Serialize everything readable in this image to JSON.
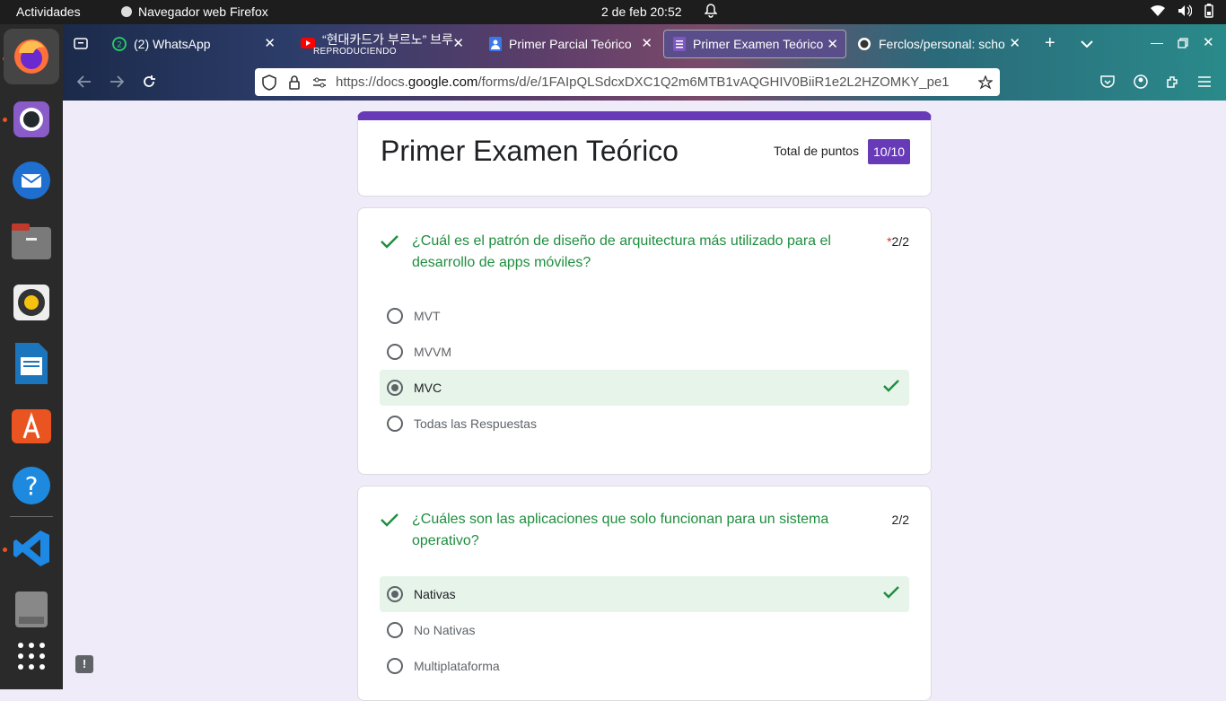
{
  "topbar": {
    "activities": "Actividades",
    "app_name": "Navegador web Firefox",
    "datetime": "2 de feb  20:52"
  },
  "dock": {
    "icons": [
      "firefox-icon",
      "github-icon",
      "thunderbird-icon",
      "files-icon",
      "rhythmbox-icon",
      "writer-icon",
      "app-center-icon",
      "help-icon",
      "vscode-icon",
      "ssd-icon",
      "apps-grid-icon"
    ]
  },
  "tabs": [
    {
      "title": "(2) WhatsApp"
    },
    {
      "title": "“현대카드가 부르노” 브루",
      "subtitle": "REPRODUCIENDO"
    },
    {
      "title": "Primer Parcial Teórico"
    },
    {
      "title": "Primer Examen Teórico"
    },
    {
      "title": "Ferclos/personal: scho"
    }
  ],
  "url": {
    "prefix": "https://docs.",
    "domain": "google.com",
    "path": "/forms/d/e/1FAIpQLSdcxDXC1Q2m6MTB1vAQGHIV0BiiR1e2L2HZOMKY_pe1"
  },
  "form": {
    "title": "Primer Examen Teórico",
    "total_label": "Total de puntos",
    "total_score": "10/10",
    "questions": [
      {
        "text": "¿Cuál es el patrón de diseño de arquitectura más utilizado para el desarrollo de apps móviles?",
        "required": "*",
        "score": "2/2",
        "options": [
          "MVT",
          "MVVM",
          "MVC",
          "Todas las Respuestas"
        ],
        "selected": "MVC"
      },
      {
        "text": "¿Cuáles son las aplicaciones que solo funcionan para un sistema operativo?",
        "score": "2/2",
        "options": [
          "Nativas",
          "No Nativas",
          "Multiplataforma"
        ],
        "selected": "Nativas"
      }
    ]
  },
  "colors": {
    "accent": "#673ab7",
    "correct": "#1e8e3e",
    "correct_bg": "#e6f4ea"
  }
}
